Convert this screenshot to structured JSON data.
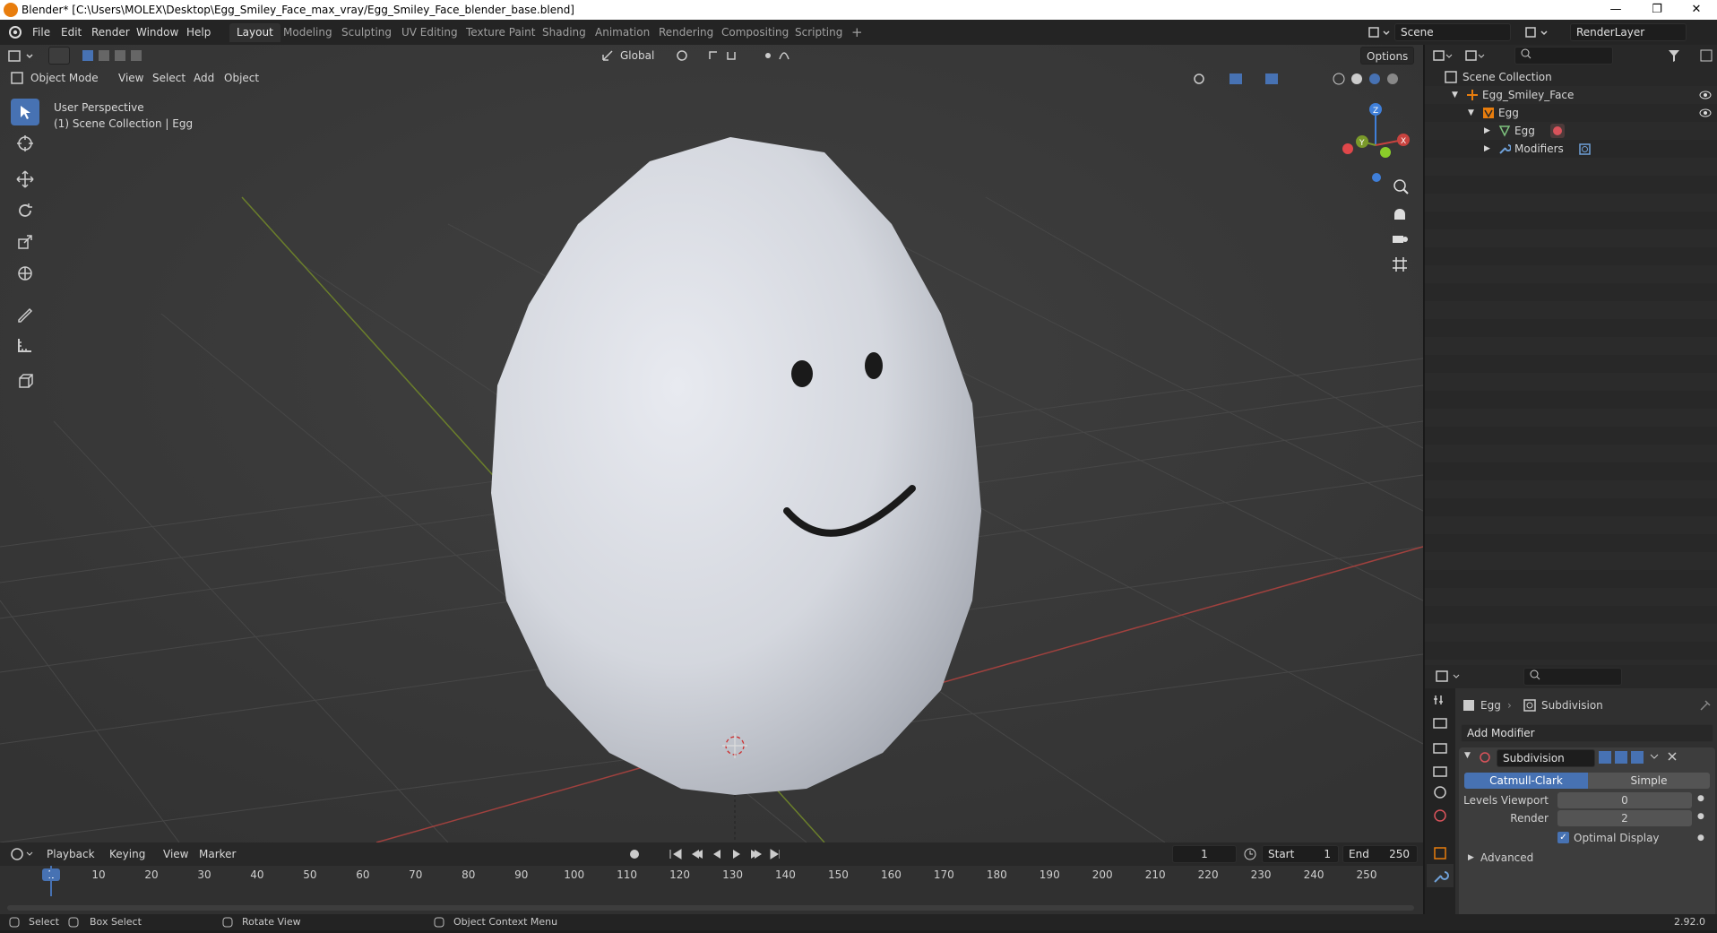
{
  "window": {
    "title": "Blender* [C:\\Users\\MOLEX\\Desktop\\Egg_Smiley_Face_max_vray/Egg_Smiley_Face_blender_base.blend]"
  },
  "menu": [
    "File",
    "Edit",
    "Render",
    "Window",
    "Help"
  ],
  "workspaces": [
    "Layout",
    "Modeling",
    "Sculpting",
    "UV Editing",
    "Texture Paint",
    "Shading",
    "Animation",
    "Rendering",
    "Compositing",
    "Scripting"
  ],
  "active_workspace": "Layout",
  "scene": {
    "name": "Scene",
    "render_layer": "RenderLayer"
  },
  "toolbar": {
    "transform_orientation": "Global",
    "options_label": "Options"
  },
  "viewport_header": {
    "mode": "Object Mode",
    "menus": [
      "View",
      "Select",
      "Add",
      "Object"
    ]
  },
  "viewport": {
    "perspective": "User Perspective",
    "collection_info": "(1) Scene Collection | Egg"
  },
  "gizmo": {
    "x": "X",
    "y": "Y",
    "z": "Z"
  },
  "outliner": {
    "root": "Scene Collection",
    "items": [
      {
        "label": "Egg_Smiley_Face"
      },
      {
        "label": "Egg"
      },
      {
        "label": "Egg"
      },
      {
        "label": "Modifiers"
      }
    ]
  },
  "properties": {
    "object": "Egg",
    "modifier_name_header": "Subdivision",
    "add_modifier": "Add Modifier",
    "modifier": {
      "name": "Subdivision",
      "types": [
        "Catmull-Clark",
        "Simple"
      ],
      "active_type": "Catmull-Clark",
      "levels_viewport_label": "Levels Viewport",
      "levels_viewport": "0",
      "render_label": "Render",
      "render": "2",
      "optimal_display_label": "Optimal Display",
      "optimal_display": true,
      "advanced_label": "Advanced"
    }
  },
  "timeline": {
    "menus": [
      "Playback",
      "Keying",
      "View",
      "Marker"
    ],
    "current_frame": "1",
    "start_label": "Start",
    "start": "1",
    "end_label": "End",
    "end": "250",
    "ticks": [
      "1",
      "10",
      "20",
      "30",
      "40",
      "50",
      "60",
      "70",
      "80",
      "90",
      "100",
      "110",
      "120",
      "130",
      "140",
      "150",
      "160",
      "170",
      "180",
      "190",
      "200",
      "210",
      "220",
      "230",
      "240",
      "250"
    ]
  },
  "status_bar": {
    "select": "Select",
    "box_select": "Box Select",
    "rotate_view": "Rotate View",
    "context_menu": "Object Context Menu",
    "version": "2.92.0"
  },
  "colors": {
    "accent": "#4772b3",
    "orange": "#e87d0d",
    "x_axis": "#c8433f",
    "y_axis": "#7a9a2a",
    "z_axis": "#3f7fd9"
  }
}
